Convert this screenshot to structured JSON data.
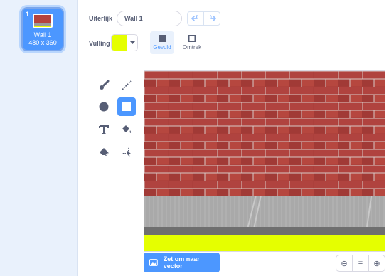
{
  "costume": {
    "number": "1",
    "name": "Wall 1",
    "size": "480 x 360"
  },
  "toolbar": {
    "appearance_label": "Uiterlijk",
    "costume_name_value": "Wall 1",
    "fill_label": "Vulling",
    "fill_color": "#e5ff00",
    "filled_label": "Gevuld",
    "outline_label": "Omtrek"
  },
  "tools": [
    {
      "name": "brush-icon"
    },
    {
      "name": "line-icon"
    },
    {
      "name": "circle-icon"
    },
    {
      "name": "rectangle-icon"
    },
    {
      "name": "text-icon"
    },
    {
      "name": "fill-icon"
    },
    {
      "name": "eraser-icon"
    },
    {
      "name": "select-icon"
    }
  ],
  "canvas": {
    "brick_color": "#a83c38",
    "ground_color": "#a9a9a9",
    "grass_color": "#e5ff00"
  },
  "actions": {
    "convert_label": "Zet om naar vector",
    "zoom_out_symbol": "⊖",
    "zoom_reset_symbol": "=",
    "zoom_in_symbol": "⊕"
  },
  "colors": {
    "accent": "#4c97ff",
    "text": "#575e75"
  }
}
